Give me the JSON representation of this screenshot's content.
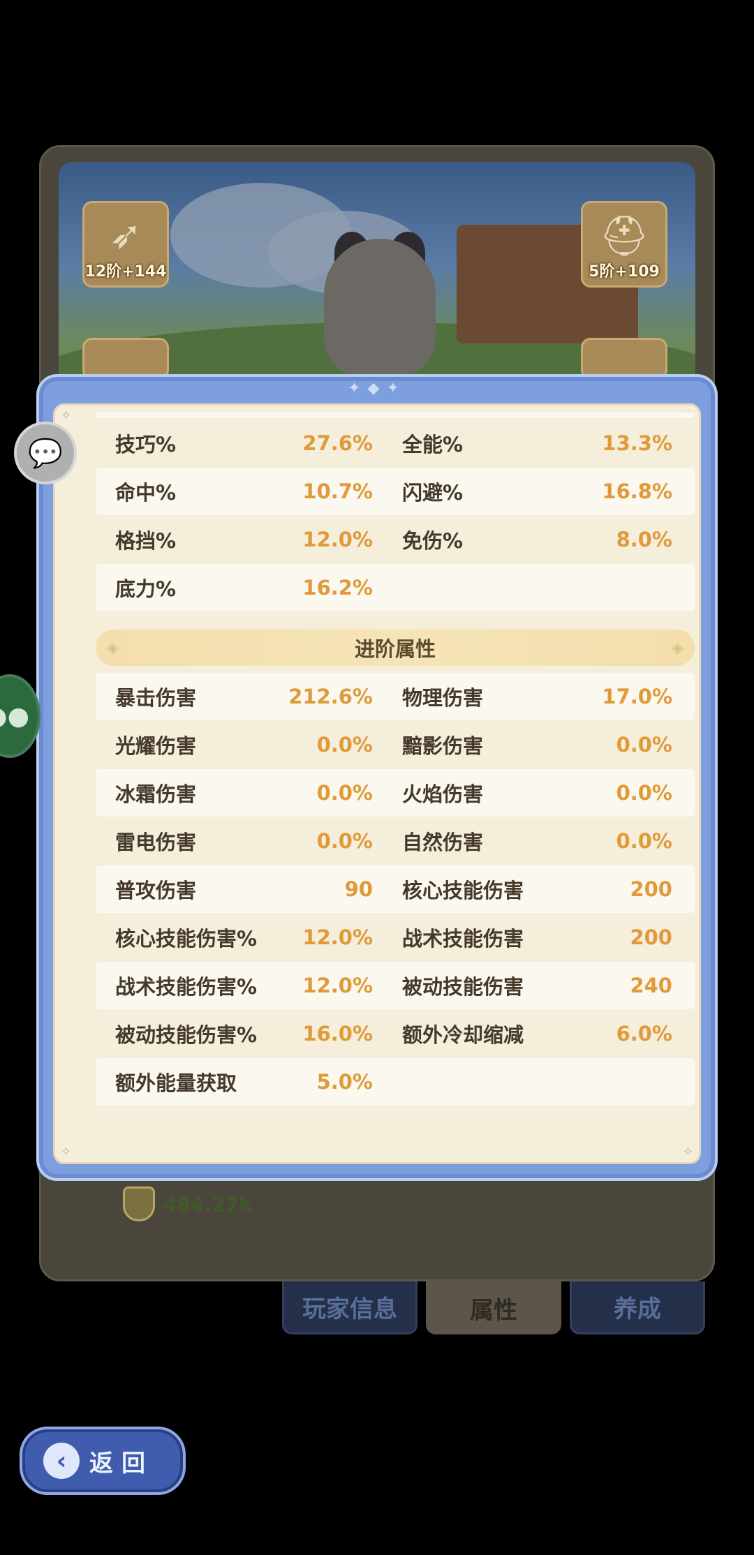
{
  "gear_slots": [
    {
      "tier": "12阶+144"
    },
    {
      "tier": "5阶+109"
    }
  ],
  "stats_basic": [
    {
      "left": {
        "label": "技巧%",
        "value": "27.6%"
      },
      "right": {
        "label": "全能%",
        "value": "13.3%"
      }
    },
    {
      "left": {
        "label": "命中%",
        "value": "10.7%"
      },
      "right": {
        "label": "闪避%",
        "value": "16.8%"
      }
    },
    {
      "left": {
        "label": "格挡%",
        "value": "12.0%"
      },
      "right": {
        "label": "免伤%",
        "value": "8.0%"
      }
    },
    {
      "left": {
        "label": "底力%",
        "value": "16.2%"
      },
      "right": {
        "label": "",
        "value": ""
      }
    }
  ],
  "advanced_section": {
    "title": "进阶属性"
  },
  "stats_advanced": [
    {
      "left": {
        "label": "暴击伤害",
        "value": "212.6%"
      },
      "right": {
        "label": "物理伤害",
        "value": "17.0%"
      }
    },
    {
      "left": {
        "label": "光耀伤害",
        "value": "0.0%"
      },
      "right": {
        "label": "黯影伤害",
        "value": "0.0%"
      }
    },
    {
      "left": {
        "label": "冰霜伤害",
        "value": "0.0%"
      },
      "right": {
        "label": "火焰伤害",
        "value": "0.0%"
      }
    },
    {
      "left": {
        "label": "雷电伤害",
        "value": "0.0%"
      },
      "right": {
        "label": "自然伤害",
        "value": "0.0%"
      }
    },
    {
      "left": {
        "label": "普攻伤害",
        "value": "90"
      },
      "right": {
        "label": "核心技能伤害",
        "value": "200"
      }
    },
    {
      "left": {
        "label": "核心技能伤害%",
        "value": "12.0%"
      },
      "right": {
        "label": "战术技能伤害",
        "value": "200"
      }
    },
    {
      "left": {
        "label": "战术技能伤害%",
        "value": "12.0%"
      },
      "right": {
        "label": "被动技能伤害",
        "value": "240"
      }
    },
    {
      "left": {
        "label": "被动技能伤害%",
        "value": "16.0%"
      },
      "right": {
        "label": "额外冷却缩减",
        "value": "6.0%"
      }
    },
    {
      "left": {
        "label": "额外能量获取",
        "value": "5.0%"
      },
      "right": {
        "label": "",
        "value": ""
      }
    }
  ],
  "power": {
    "value": "484.27k"
  },
  "tabs": [
    {
      "label": "玩家信息",
      "active": false
    },
    {
      "label": "属性",
      "active": true
    },
    {
      "label": "养成",
      "active": false
    }
  ],
  "back_button": {
    "label": "返回"
  },
  "icons": {
    "chat": "chat-bubble-icon",
    "wechat": "wechat-icon",
    "back": "back-arrow-icon",
    "power": "shield-icon"
  }
}
